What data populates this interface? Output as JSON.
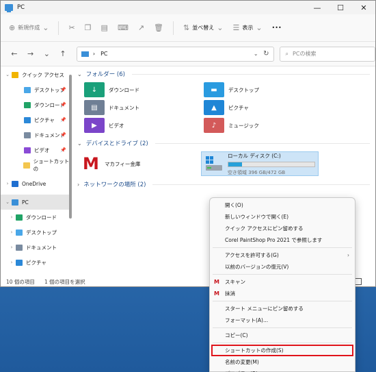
{
  "window": {
    "title": "PC"
  },
  "window_controls": {
    "minimize": "—",
    "maximize": "☐",
    "close": "✕"
  },
  "toolbar": {
    "new_label": "新規作成",
    "sort_label": "並べ替え",
    "view_label": "表示",
    "more_label": "•••"
  },
  "addressbar": {
    "path": "PC",
    "separator": "›"
  },
  "search": {
    "placeholder": "PCの検索"
  },
  "sidebar": {
    "items": [
      {
        "label": "クイック アクセス",
        "color": "#f1b400"
      },
      {
        "label": "デスクトップ",
        "color": "#4aa7e8"
      },
      {
        "label": "ダウンロード",
        "color": "#21a366"
      },
      {
        "label": "ピクチャ",
        "color": "#2b88d8"
      },
      {
        "label": "ドキュメント",
        "color": "#7a8ba0"
      },
      {
        "label": "ビデオ",
        "color": "#8a4bd6"
      },
      {
        "label": "ショートカットの",
        "color": "#f3c64f"
      },
      {
        "label": "OneDrive",
        "color": "#1f6fd0"
      },
      {
        "label": "PC",
        "color": "#3a8fd8"
      },
      {
        "label": "ダウンロード",
        "color": "#21a366"
      },
      {
        "label": "デスクトップ",
        "color": "#4aa7e8"
      },
      {
        "label": "ドキュメント",
        "color": "#7a8ba0"
      },
      {
        "label": "ピクチャ",
        "color": "#2b88d8"
      }
    ]
  },
  "content": {
    "folders_header": "フォルダー (6)",
    "folders": [
      {
        "label": "ダウンロード",
        "color": "#1aa07a",
        "icon": "download-folder-icon"
      },
      {
        "label": "デスクトップ",
        "color": "#2a9be0",
        "icon": "desktop-folder-icon"
      },
      {
        "label": "ドキュメント",
        "color": "#6f7f95",
        "icon": "documents-folder-icon"
      },
      {
        "label": "ピクチャ",
        "color": "#1f86d6",
        "icon": "pictures-folder-icon"
      },
      {
        "label": "ビデオ",
        "color": "#7b45c9",
        "icon": "videos-folder-icon"
      },
      {
        "label": "ミュージック",
        "color": "#d35a5a",
        "icon": "music-folder-icon"
      }
    ],
    "drives_header": "デバイスとドライブ (2)",
    "mcafee_label": "マカフィー金庫",
    "local_disk": {
      "label": "ローカル ディスク (C:)",
      "free": "空き領域 396 GB/472 GB",
      "used_fraction": 0.16
    },
    "network_header": "ネットワークの場所 (2)"
  },
  "statusbar": {
    "count": "10 個の項目",
    "selected": "1 個の項目を選択"
  },
  "context_menu": {
    "items": [
      {
        "label": "開く(O)"
      },
      {
        "label": "新しいウィンドウで開く(E)"
      },
      {
        "label": "クイック アクセスにピン留めする"
      },
      {
        "label": "Corel PaintShop Pro 2021 で参照します"
      },
      {
        "label": "アクセスを許可する(G)"
      },
      {
        "label": "以前のバージョンの復元(V)"
      },
      {
        "label": "スキャン"
      },
      {
        "label": "抹消"
      },
      {
        "label": "スタート メニューにピン留めする"
      },
      {
        "label": "フォーマット(A)..."
      },
      {
        "label": "コピー(C)"
      },
      {
        "label": "ショートカットの作成(S)"
      },
      {
        "label": "名前の変更(M)"
      },
      {
        "label": "プロパティ(R)"
      }
    ]
  }
}
